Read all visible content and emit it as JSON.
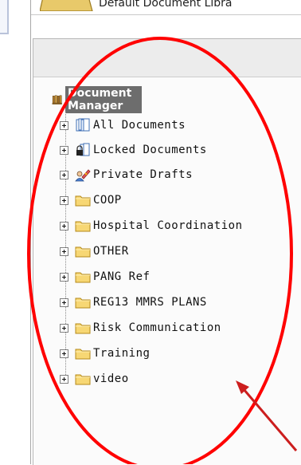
{
  "header": {
    "library_title": "Default Document Libra"
  },
  "tree": {
    "root_label": "Document Manager",
    "nodes": [
      {
        "label": "All Documents",
        "icon": "all-documents-icon"
      },
      {
        "label": "Locked Documents",
        "icon": "locked-documents-icon"
      },
      {
        "label": "Private Drafts",
        "icon": "private-drafts-icon"
      },
      {
        "label": "COOP",
        "icon": "folder-icon"
      },
      {
        "label": "Hospital Coordination",
        "icon": "folder-icon"
      },
      {
        "label": "OTHER",
        "icon": "folder-icon"
      },
      {
        "label": "PANG Ref",
        "icon": "folder-icon"
      },
      {
        "label": "REG13 MMRS PLANS",
        "icon": "folder-icon"
      },
      {
        "label": "Risk Communication",
        "icon": "folder-icon"
      },
      {
        "label": "Training",
        "icon": "folder-icon"
      },
      {
        "label": "video",
        "icon": "folder-icon"
      }
    ]
  },
  "annotation": {
    "color": "#ff0000"
  }
}
